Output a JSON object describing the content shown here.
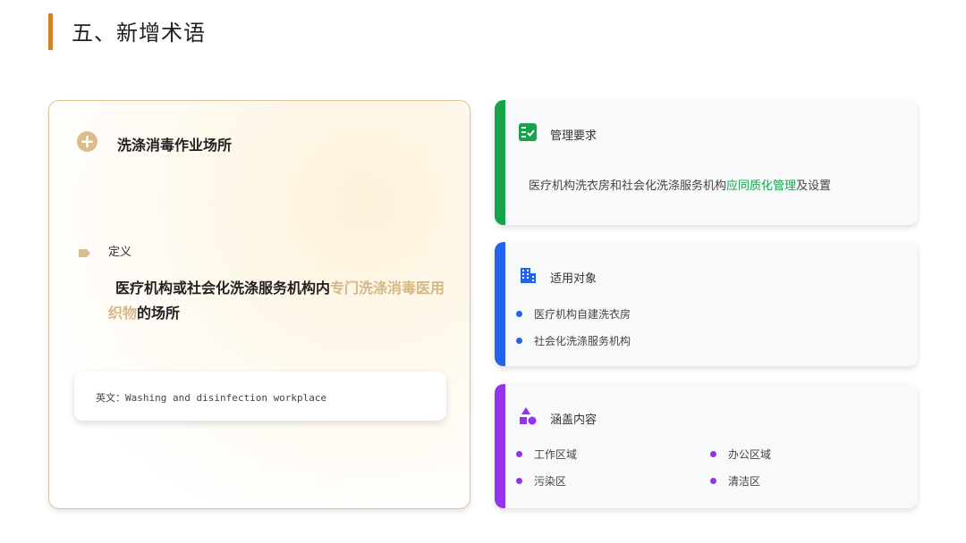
{
  "page": {
    "title": "五、新增术语"
  },
  "term": {
    "name": "洗涤消毒作业场所",
    "definition_label": "定义",
    "definition_prefix": "医疗机构或社会化洗涤服务机构内",
    "definition_highlight": "专门洗涤消毒医用织物",
    "definition_suffix": "的场所",
    "english": "英文：Washing and disinfection workplace"
  },
  "management": {
    "title": "管理要求",
    "text_prefix": "医疗机构洗衣房和社会化洗涤服务机构",
    "text_highlight": "应同质化管理",
    "text_suffix": "及设置"
  },
  "applicable": {
    "title": "适用对象",
    "items": [
      "医疗机构自建洗衣房",
      "社会化洗涤服务机构"
    ]
  },
  "coverage": {
    "title": "涵盖内容",
    "items": [
      "工作区域",
      "办公区域",
      "污染区",
      "清洁区"
    ]
  },
  "colors": {
    "accent_orange": "#d4822a",
    "gold": "#d4b888",
    "green": "#16a34a",
    "blue": "#2563eb",
    "purple": "#9333ea"
  }
}
